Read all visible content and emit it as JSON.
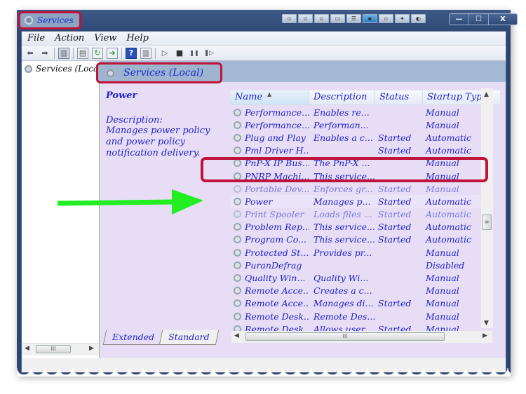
{
  "window": {
    "title": "Services",
    "controls": {
      "minimize": "—",
      "maximize": "☐",
      "close": "X"
    }
  },
  "menu": {
    "items": [
      "File",
      "Action",
      "View",
      "Help"
    ]
  },
  "toolbar": {
    "buttons": [
      "back-icon",
      "forward-icon",
      "show-hide-console-tree-icon",
      "properties-icon",
      "refresh-icon",
      "export-list-icon",
      "help-icon",
      "show-hide-action-pane-icon",
      "start-service-icon",
      "stop-service-icon",
      "pause-service-icon",
      "restart-service-icon"
    ],
    "help_glyph": "?",
    "play_glyph": "▷",
    "stop_glyph": "■",
    "pause_glyph": "❚❚",
    "restart_glyph": "❚▷"
  },
  "tree": {
    "items": [
      {
        "label": "Services (Local)"
      }
    ]
  },
  "pane": {
    "header_title": "Services (Local)",
    "selected": {
      "name": "Power",
      "description_label": "Description:",
      "description": "Manages power policy and power policy notification delivery."
    },
    "columns": [
      {
        "label": "Name",
        "sorted": "ascending"
      },
      {
        "label": "Description"
      },
      {
        "label": "Status"
      },
      {
        "label": "Startup Type"
      }
    ],
    "rows": [
      {
        "name": "Performance...",
        "description": "Enables re...",
        "status": "",
        "startup": "Manual"
      },
      {
        "name": "Performance...",
        "description": "Performan...",
        "status": "",
        "startup": "Manual"
      },
      {
        "name": "Plug and Play",
        "description": "Enables a c...",
        "status": "Started",
        "startup": "Automatic"
      },
      {
        "name": "Pml Driver H...",
        "description": "",
        "status": "Started",
        "startup": "Automatic"
      },
      {
        "name": "PnP-X IP Bus...",
        "description": "The PnP-X ...",
        "status": "",
        "startup": "Manual"
      },
      {
        "name": "PNRP Machi...",
        "description": "This service...",
        "status": "",
        "startup": "Manual"
      },
      {
        "name": "Portable Dev...",
        "description": "Enforces gr...",
        "status": "Started",
        "startup": "Manual"
      },
      {
        "name": "Power",
        "description": "Manages p...",
        "status": "Started",
        "startup": "Automatic",
        "selected": true
      },
      {
        "name": "Print Spooler",
        "description": "Loads files ...",
        "status": "Started",
        "startup": "Automatic"
      },
      {
        "name": "Problem Rep...",
        "description": "This service...",
        "status": "Started",
        "startup": "Automatic"
      },
      {
        "name": "Program Co...",
        "description": "This service...",
        "status": "Started",
        "startup": "Automatic"
      },
      {
        "name": "Protected St...",
        "description": "Provides pr...",
        "status": "",
        "startup": "Manual"
      },
      {
        "name": "PuranDefrag",
        "description": "",
        "status": "",
        "startup": "Disabled"
      },
      {
        "name": "Quality Win...",
        "description": "Quality Wi...",
        "status": "",
        "startup": "Manual"
      },
      {
        "name": "Remote Acce...",
        "description": "Creates a c...",
        "status": "",
        "startup": "Manual"
      },
      {
        "name": "Remote Acce...",
        "description": "Manages di...",
        "status": "Started",
        "startup": "Manual"
      },
      {
        "name": "Remote Desk...",
        "description": "Remote Des...",
        "status": "",
        "startup": "Manual"
      },
      {
        "name": "Remote Desk...",
        "description": "Allows user...",
        "status": "Started",
        "startup": "Manual"
      }
    ],
    "tabs": [
      {
        "label": "Extended",
        "active": true
      },
      {
        "label": "Standard",
        "active": false
      }
    ]
  },
  "scrollbars": {
    "arrow_up": "▲",
    "arrow_down": "▼",
    "arrow_left": "◀",
    "arrow_right": "▶",
    "grip": "≡",
    "hgrip": "III"
  },
  "annotations": {
    "highlight_color": "#c0133a",
    "arrow_color": "#22ee22"
  },
  "colors": {
    "text_accent": "#2222cc",
    "pane_background": "#e7def6",
    "header_background": "#a4b9d4"
  }
}
